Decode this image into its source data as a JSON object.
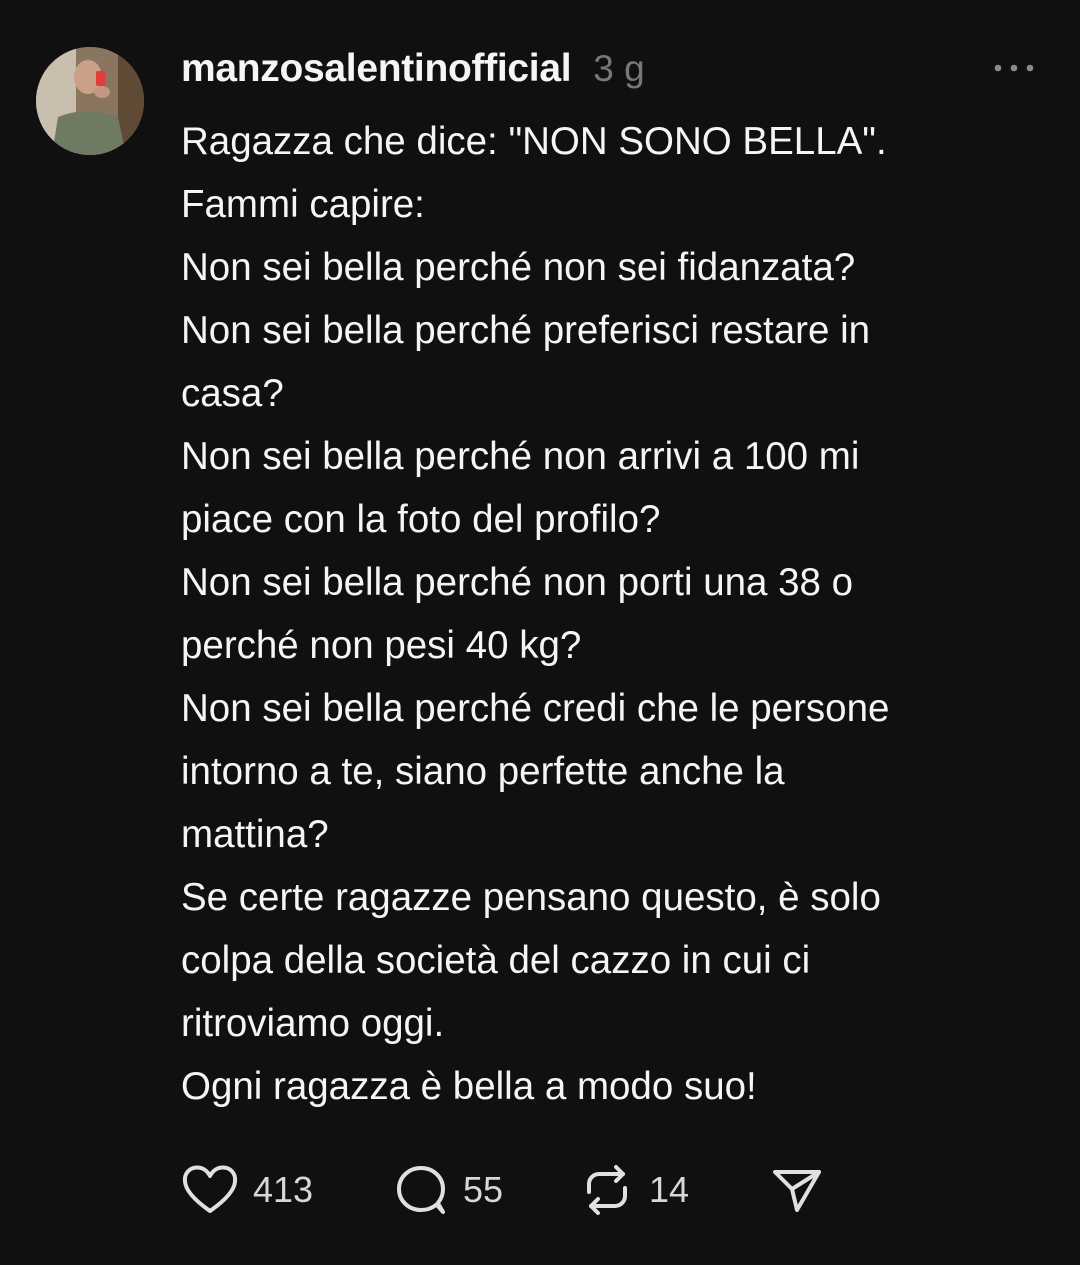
{
  "post": {
    "author": {
      "username": "manzosalentinofficial",
      "avatar_icon": "profile-photo-avatar"
    },
    "time_ago": "3 g",
    "more_icon": "more-horizontal-icon",
    "text_lines": [
      "Ragazza che dice: \"NON SONO BELLA\".",
      "Fammi capire:",
      "Non sei bella perché non sei fidanzata?",
      "Non sei bella perché preferisci restare in",
      "casa?",
      "Non sei bella perché non arrivi a 100 mi",
      "piace con la foto del profilo?",
      "Non sei bella perché non porti una 38 o",
      "perché non pesi 40 kg?",
      "Non sei bella perché credi che le persone",
      "intorno a te, siano perfette anche la",
      "mattina?",
      "Se certe ragazze pensano questo, è solo",
      "colpa della società del cazzo in cui ci",
      "ritroviamo oggi.",
      "Ogni ragazza è bella a modo suo!"
    ],
    "actions": {
      "like": {
        "icon": "heart-icon",
        "count": "413"
      },
      "reply": {
        "icon": "comment-bubble-icon",
        "count": "55"
      },
      "repost": {
        "icon": "repost-icon",
        "count": "14"
      },
      "share": {
        "icon": "send-icon"
      }
    }
  },
  "colors": {
    "background": "#101010",
    "primary_text": "#f3f5f7",
    "secondary_text": "#777777"
  }
}
